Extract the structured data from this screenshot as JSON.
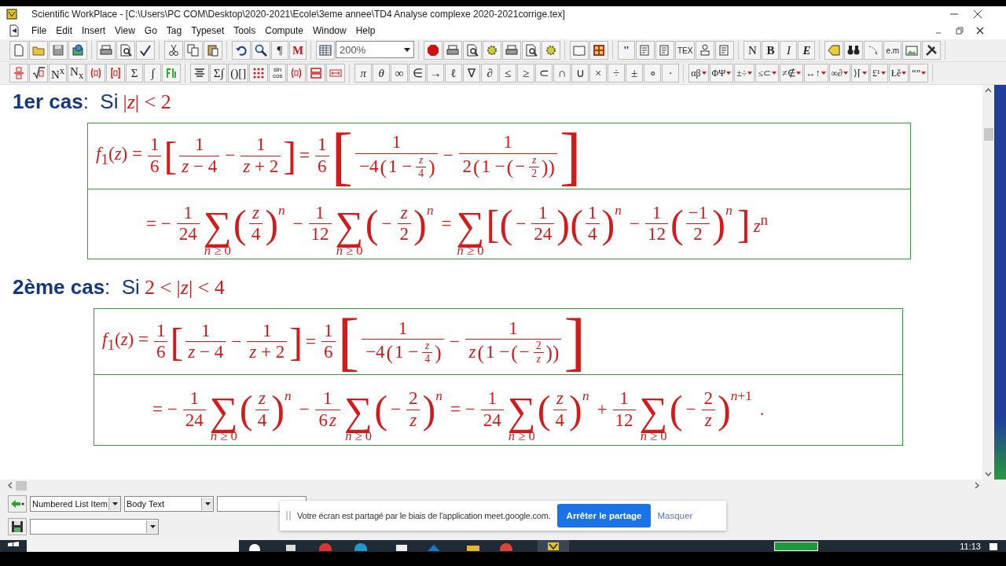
{
  "window": {
    "title": "Scientific WorkPlace - [C:\\Users\\PC COM\\Desktop\\2020-2021\\Ecole\\3eme annee\\TD4 Analyse complexe 2020-2021corrige.tex]"
  },
  "menu": [
    "File",
    "Edit",
    "Insert",
    "View",
    "Go",
    "Tag",
    "Typeset",
    "Tools",
    "Compute",
    "Window",
    "Help"
  ],
  "toolbars": [
    [
      [
        {
          "kind": "icon"
        },
        {
          "kind": "icon"
        },
        {
          "kind": "icon"
        },
        {
          "kind": "icon"
        }
      ],
      [
        {
          "kind": "icon"
        },
        {
          "kind": "icon"
        },
        {
          "kind": "icon"
        }
      ],
      [
        {
          "kind": "icon"
        },
        {
          "kind": "icon"
        },
        {
          "kind": "icon"
        }
      ],
      [
        {
          "kind": "icon"
        },
        {
          "kind": "icon"
        },
        {
          "kind": "glyph",
          "text": "¶"
        },
        {
          "kind": "glyph",
          "text": "M"
        }
      ],
      [
        {
          "kind": "icon"
        },
        {
          "kind": "combo",
          "text": "200%"
        }
      ],
      [
        {
          "kind": "icon"
        },
        {
          "kind": "icon"
        },
        {
          "kind": "icon"
        },
        {
          "kind": "icon"
        },
        {
          "kind": "icon"
        },
        {
          "kind": "icon"
        },
        {
          "kind": "icon"
        }
      ],
      [
        {
          "kind": "icon"
        },
        {
          "kind": "icon"
        }
      ],
      [
        {
          "kind": "glyph",
          "text": "\""
        },
        {
          "kind": "icon"
        },
        {
          "kind": "icon"
        },
        {
          "kind": "glyph",
          "text": "TEX"
        },
        {
          "kind": "icon"
        },
        {
          "kind": "icon"
        }
      ],
      [
        {
          "kind": "glyph",
          "text": "N"
        },
        {
          "kind": "glyph",
          "text": "B"
        },
        {
          "kind": "glyph",
          "text": "I"
        },
        {
          "kind": "glyph",
          "text": "E"
        }
      ],
      [
        {
          "kind": "icon"
        },
        {
          "kind": "icon"
        },
        {
          "kind": "icon"
        },
        {
          "kind": "glyph",
          "text": "e.m"
        },
        {
          "kind": "icon"
        },
        {
          "kind": "icon"
        }
      ]
    ],
    [
      [
        {
          "kind": "icon"
        },
        {
          "kind": "icon"
        },
        {
          "kind": "glyph",
          "text": "N$^{x}$"
        },
        {
          "kind": "glyph",
          "text": "N$_{x}$"
        },
        {
          "kind": "icon"
        },
        {
          "kind": "icon"
        },
        {
          "kind": "glyph",
          "text": "Σ"
        },
        {
          "kind": "glyph",
          "text": "∫"
        },
        {
          "kind": "icon"
        }
      ],
      [
        {
          "kind": "icon"
        },
        {
          "kind": "glyph",
          "text": "Σ∫"
        },
        {
          "kind": "glyph",
          "text": "()[]"
        },
        {
          "kind": "icon"
        },
        {
          "kind": "glyph",
          "text": "sin cos"
        },
        {
          "kind": "icon"
        },
        {
          "kind": "icon"
        },
        {
          "kind": "icon"
        }
      ],
      [
        {
          "kind": "glyph",
          "text": "π"
        },
        {
          "kind": "glyph",
          "text": "θ"
        },
        {
          "kind": "glyph",
          "text": "∞"
        },
        {
          "kind": "glyph",
          "text": "∈"
        },
        {
          "kind": "glyph",
          "text": "→"
        },
        {
          "kind": "glyph",
          "text": "ℓ"
        },
        {
          "kind": "glyph",
          "text": "∇"
        },
        {
          "kind": "glyph",
          "text": "∂"
        },
        {
          "kind": "glyph",
          "text": "≤"
        },
        {
          "kind": "glyph",
          "text": "≥"
        },
        {
          "kind": "glyph",
          "text": "⊂"
        },
        {
          "kind": "glyph",
          "text": "∩"
        },
        {
          "kind": "glyph",
          "text": "∪"
        },
        {
          "kind": "glyph",
          "text": "×"
        },
        {
          "kind": "glyph",
          "text": "÷"
        },
        {
          "kind": "glyph",
          "text": "±"
        },
        {
          "kind": "glyph",
          "text": "∘"
        },
        {
          "kind": "glyph",
          "text": "·"
        }
      ],
      [
        {
          "kind": "menu",
          "text": "αβ"
        },
        {
          "kind": "menu",
          "text": "ΦΨ"
        },
        {
          "kind": "menu",
          "text": "±÷"
        },
        {
          "kind": "menu",
          "text": "≤⊂"
        },
        {
          "kind": "menu",
          "text": "≠∉"
        },
        {
          "kind": "menu",
          "text": "↔↑"
        },
        {
          "kind": "menu",
          "text": "∞∂"
        },
        {
          "kind": "menu",
          "text": "⟩⌈"
        },
        {
          "kind": "menu",
          "text": "£¹"
        },
        {
          "kind": "menu",
          "text": "Łě"
        },
        {
          "kind": "menu",
          "text": "“”"
        }
      ]
    ]
  ],
  "sections": [
    {
      "title": "1er cas",
      "label": ":  Si",
      "condition": "|*z*| < 2",
      "lines": [
        {
          "items": [
            {
              "kind": "text",
              "text": "*f*$_{1}$(*z*) ="
            },
            {
              "kind": "frac",
              "num": "1",
              "den": "6"
            },
            {
              "kind": "delim",
              "text": "["
            },
            {
              "kind": "frac",
              "num": "1",
              "den": "*z* − 4"
            },
            {
              "kind": "text",
              "text": "−"
            },
            {
              "kind": "frac",
              "num": "1",
              "den": "*z* + 2"
            },
            {
              "kind": "delim",
              "text": "]"
            },
            {
              "kind": "text",
              "text": "="
            },
            {
              "kind": "frac",
              "num": "1",
              "den": "6"
            },
            {
              "kind": "delim",
              "text": "["
            },
            {
              "kind": "frac",
              "num": "1",
              "den": [
                {
                  "kind": "text",
                  "text": "−4"
                },
                {
                  "kind": "delim",
                  "text": "("
                },
                {
                  "kind": "text",
                  "text": "1 −"
                },
                {
                  "kind": "frac",
                  "num": "*z*",
                  "den": "4"
                },
                {
                  "kind": "delim",
                  "text": ")"
                }
              ]
            },
            {
              "kind": "text",
              "text": "−"
            },
            {
              "kind": "frac",
              "num": "1",
              "den": [
                {
                  "kind": "text",
                  "text": "2"
                },
                {
                  "kind": "delim",
                  "text": "("
                },
                {
                  "kind": "text",
                  "text": "1 −"
                },
                {
                  "kind": "delim",
                  "text": "("
                },
                {
                  "kind": "text",
                  "text": "−"
                },
                {
                  "kind": "frac",
                  "num": "*z*",
                  "den": "2"
                },
                {
                  "kind": "delim",
                  "text": ")"
                },
                {
                  "kind": "delim",
                  "text": ")"
                }
              ]
            },
            {
              "kind": "delim",
              "text": "]"
            }
          ]
        },
        {
          "items": [
            {
              "kind": "text",
              "text": "= −"
            },
            {
              "kind": "frac",
              "num": "1",
              "den": "24"
            },
            {
              "kind": "sum",
              "sign": "∑",
              "sub": "*n* ≥ 0"
            },
            {
              "kind": "delim",
              "text": "("
            },
            {
              "kind": "frac",
              "num": "*z*",
              "den": "4"
            },
            {
              "kind": "delim",
              "text": ")",
              "sup": "*n*"
            },
            {
              "kind": "text",
              "text": "−"
            },
            {
              "kind": "frac",
              "num": "1",
              "den": "12"
            },
            {
              "kind": "sum",
              "sign": "∑",
              "sub": "*n* ≥ 0"
            },
            {
              "kind": "delim",
              "text": "("
            },
            {
              "kind": "text",
              "text": "−"
            },
            {
              "kind": "frac",
              "num": "*z*",
              "den": "2"
            },
            {
              "kind": "delim",
              "text": ")",
              "sup": "*n*"
            },
            {
              "kind": "text",
              "text": "="
            },
            {
              "kind": "sum",
              "sign": "∑",
              "sub": "*n* ≥ 0"
            },
            {
              "kind": "delim",
              "text": "["
            },
            {
              "kind": "delim",
              "text": "("
            },
            {
              "kind": "text",
              "text": "−"
            },
            {
              "kind": "frac",
              "num": "1",
              "den": "24"
            },
            {
              "kind": "delim",
              "text": ")"
            },
            {
              "kind": "delim",
              "text": "("
            },
            {
              "kind": "frac",
              "num": "1",
              "den": "4"
            },
            {
              "kind": "delim",
              "text": ")",
              "sup": "*n*"
            },
            {
              "kind": "text",
              "text": "−"
            },
            {
              "kind": "frac",
              "num": "1",
              "den": "12"
            },
            {
              "kind": "delim",
              "text": "("
            },
            {
              "kind": "frac",
              "num": "−1",
              "den": "2"
            },
            {
              "kind": "delim",
              "text": ")",
              "sup": "*n*"
            },
            {
              "kind": "delim",
              "text": "]"
            },
            {
              "kind": "text",
              "text": "*z*$^{n}$"
            }
          ]
        }
      ]
    },
    {
      "title": "2ème cas",
      "label": ":  Si",
      "condition": "2 < |*z*| < 4",
      "lines": [
        {
          "items": [
            {
              "kind": "text",
              "text": "*f*$_{1}$(*z*) ="
            },
            {
              "kind": "frac",
              "num": "1",
              "den": "6"
            },
            {
              "kind": "delim",
              "text": "["
            },
            {
              "kind": "frac",
              "num": "1",
              "den": "*z* − 4"
            },
            {
              "kind": "text",
              "text": "−"
            },
            {
              "kind": "frac",
              "num": "1",
              "den": "*z* + 2"
            },
            {
              "kind": "delim",
              "text": "]"
            },
            {
              "kind": "text",
              "text": "="
            },
            {
              "kind": "frac",
              "num": "1",
              "den": "6"
            },
            {
              "kind": "delim",
              "text": "["
            },
            {
              "kind": "frac",
              "num": "1",
              "den": [
                {
                  "kind": "text",
                  "text": "−4"
                },
                {
                  "kind": "delim",
                  "text": "("
                },
                {
                  "kind": "text",
                  "text": "1 −"
                },
                {
                  "kind": "frac",
                  "num": "*z*",
                  "den": "4"
                },
                {
                  "kind": "delim",
                  "text": ")"
                }
              ]
            },
            {
              "kind": "text",
              "text": "−"
            },
            {
              "kind": "frac",
              "num": "1",
              "den": [
                {
                  "kind": "text",
                  "text": "*z*"
                },
                {
                  "kind": "delim",
                  "text": "("
                },
                {
                  "kind": "text",
                  "text": "1 −"
                },
                {
                  "kind": "delim",
                  "text": "("
                },
                {
                  "kind": "text",
                  "text": "−"
                },
                {
                  "kind": "frac",
                  "num": "2",
                  "den": "*z*"
                },
                {
                  "kind": "delim",
                  "text": ")"
                },
                {
                  "kind": "delim",
                  "text": ")"
                }
              ]
            },
            {
              "kind": "delim",
              "text": "]"
            }
          ]
        },
        {
          "items": [
            {
              "kind": "text",
              "text": "= −"
            },
            {
              "kind": "frac",
              "num": "1",
              "den": "24"
            },
            {
              "kind": "sum",
              "sign": "∑",
              "sub": "*n* ≥ 0"
            },
            {
              "kind": "delim",
              "text": "("
            },
            {
              "kind": "frac",
              "num": "*z*",
              "den": "4"
            },
            {
              "kind": "delim",
              "text": ")",
              "sup": "*n*"
            },
            {
              "kind": "text",
              "text": "−"
            },
            {
              "kind": "frac",
              "num": "1",
              "den": [
                {
                  "kind": "text",
                  "text": "6"
                },
                {
                  "kind": "text",
                  "text": "*z*"
                }
              ]
            },
            {
              "kind": "sum",
              "sign": "∑",
              "sub": "*n* ≥ 0"
            },
            {
              "kind": "delim",
              "text": "("
            },
            {
              "kind": "text",
              "text": "−"
            },
            {
              "kind": "frac",
              "num": "2",
              "den": "*z*"
            },
            {
              "kind": "delim",
              "text": ")",
              "sup": "*n*"
            },
            {
              "kind": "text",
              "text": "= −"
            },
            {
              "kind": "frac",
              "num": "1",
              "den": "24"
            },
            {
              "kind": "sum",
              "sign": "∑",
              "sub": "*n* ≥ 0"
            },
            {
              "kind": "delim",
              "text": "("
            },
            {
              "kind": "frac",
              "num": "*z*",
              "den": "4"
            },
            {
              "kind": "delim",
              "text": ")",
              "sup": "*n*"
            },
            {
              "kind": "text",
              "text": "+"
            },
            {
              "kind": "frac",
              "num": "1",
              "den": "12"
            },
            {
              "kind": "sum",
              "sign": "∑",
              "sub": "*n* ≥ 0"
            },
            {
              "kind": "delim",
              "text": "("
            },
            {
              "kind": "text",
              "text": "−"
            },
            {
              "kind": "frac",
              "num": "2",
              "den": "*z*"
            },
            {
              "kind": "delim",
              "text": ")",
              "sup": "*n*+1"
            },
            {
              "kind": "text",
              "text": "."
            }
          ]
        }
      ]
    }
  ],
  "format_bar": {
    "tag_list": "Numbered List Item",
    "style": "Body Text"
  },
  "notification": {
    "text": "Votre écran est partagé par le biais de l'application meet.google.com.",
    "button": "Arrêter le partage",
    "link": "Masquer"
  },
  "taskbar": {
    "time": "11:13"
  }
}
